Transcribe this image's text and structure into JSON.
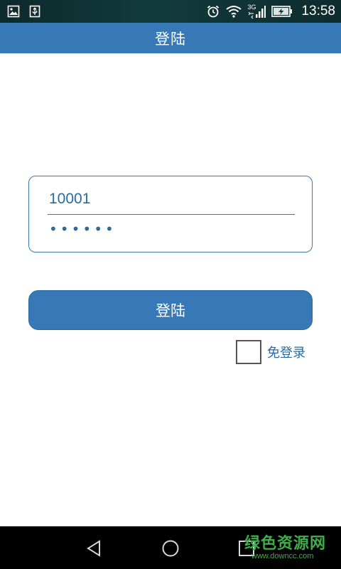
{
  "status_bar": {
    "time": "13:58",
    "network": "3G",
    "icons": [
      "image-icon",
      "usb-icon",
      "alarm-icon",
      "wifi-icon",
      "signal-icon",
      "battery-charging-icon"
    ]
  },
  "header": {
    "title": "登陆"
  },
  "login": {
    "username": "10001",
    "password_mask": "••••••",
    "button_label": "登陆",
    "auto_login_label": "免登录",
    "auto_login_checked": false
  },
  "nav": {
    "icons": [
      "back-icon",
      "home-icon",
      "recent-apps-icon"
    ]
  },
  "watermark": {
    "text_cn": "绿色资源网",
    "url": "www.downcc.com"
  },
  "colors": {
    "accent": "#3779b7",
    "status_bar": "#0d2a2b",
    "nav_bar": "#000000"
  }
}
